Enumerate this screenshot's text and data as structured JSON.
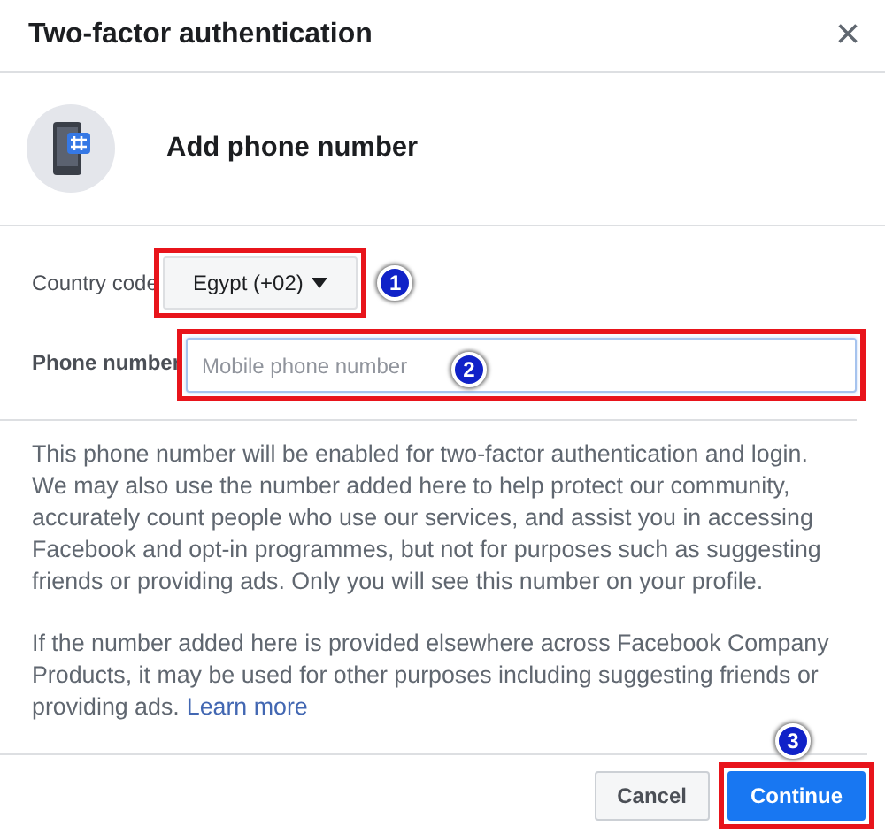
{
  "dialog": {
    "title": "Two-factor authentication",
    "close": "×"
  },
  "header": {
    "title": "Add phone number"
  },
  "form": {
    "country_code": {
      "label": "Country code",
      "value": "Egypt (+02)",
      "highlighted": true,
      "marker": "1"
    },
    "phone_number": {
      "label": "Phone number",
      "placeholder": "Mobile phone number",
      "highlighted": true,
      "marker": "2"
    }
  },
  "paragraphs": [
    {
      "text": "This phone number will be enabled for two-factor authentication and login. We may also use the number added here to help protect our community, accurately count people who use our services, and assist you in accessing Facebook and opt-in programmes, but not for purposes such as suggesting friends or providing ads. Only you will see this number on your profile."
    },
    {
      "text": "If the number added here is provided elsewhere across Facebook Company Products, it may be used for other purposes including suggesting friends or providing ads.",
      "link": "Learn more"
    }
  ],
  "buttons": [
    {
      "label": "Cancel",
      "kind": "secondary",
      "highlighted": false
    },
    {
      "label": "Continue",
      "kind": "primary",
      "highlighted": true,
      "marker": "3"
    }
  ]
}
